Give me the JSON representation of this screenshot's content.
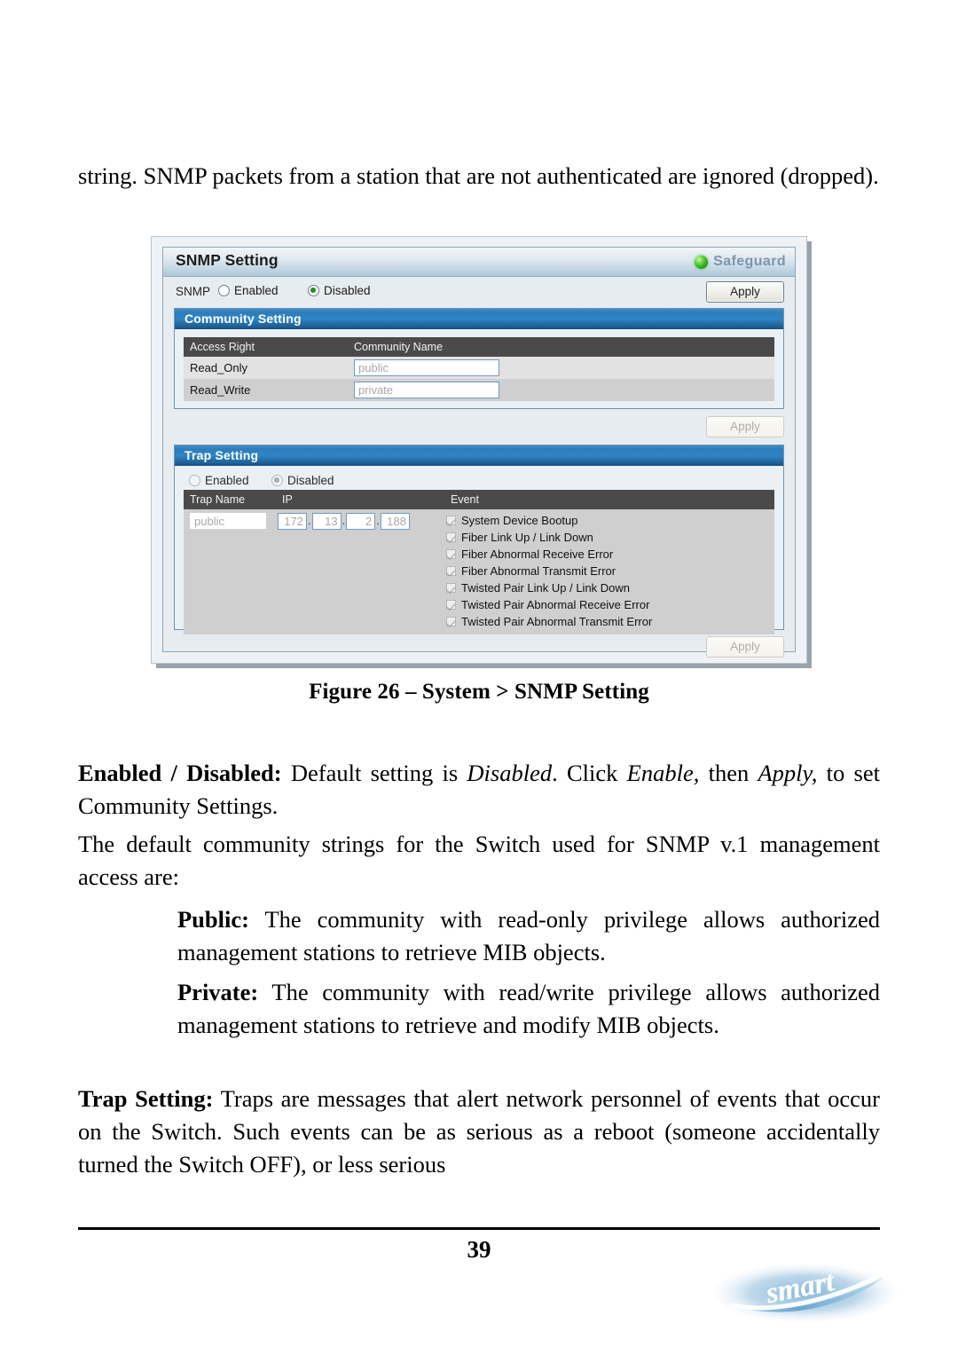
{
  "document": {
    "paragraphs": {
      "intro": "string. SNMP packets from a station that are not authenticated are ignored (dropped).",
      "enabled_disabled_lead": "Enabled / Disabled:",
      "enabled_disabled_rest_1": " Default setting is ",
      "enabled_disabled_italic_1": "Disabled",
      "enabled_disabled_rest_2": ". Click ",
      "enabled_disabled_italic_2": "Enable,",
      "enabled_disabled_rest_3": " then ",
      "enabled_disabled_italic_3": "Apply,",
      "enabled_disabled_rest_4": " to set Community Settings.",
      "default_strings": "The default community strings for the Switch used for SNMP v.1 management access are:",
      "public_lead": "Public:",
      "public_rest": " The community with read-only privilege allows authorized management stations to retrieve MIB objects.",
      "private_lead": "Private:",
      "private_rest": " The community with read/write privilege allows authorized management stations to retrieve and modify MIB objects.",
      "trap_lead": "Trap Setting:",
      "trap_rest": " Traps are messages that alert network personnel of events that occur on the Switch. Such events can be as serious as a reboot (someone accidentally turned the Switch OFF), or less serious"
    },
    "figure_caption": "Figure 26 – System > SNMP Setting",
    "page_number": "39",
    "logo_text": "smart"
  },
  "ui": {
    "title": "SNMP Setting",
    "safeguard_label": "Safeguard",
    "snmp": {
      "label": "SNMP",
      "options": [
        {
          "label": "Enabled",
          "selected": false
        },
        {
          "label": "Disabled",
          "selected": true
        }
      ],
      "apply_label": "Apply"
    },
    "community": {
      "panel_title": "Community Setting",
      "columns": [
        "Access Right",
        "Community Name"
      ],
      "rows": [
        {
          "access_right": "Read_Only",
          "community_name": "public"
        },
        {
          "access_right": "Read_Write",
          "community_name": "private"
        }
      ],
      "apply_label": "Apply",
      "apply_disabled": true
    },
    "trap": {
      "panel_title": "Trap Setting",
      "options": [
        {
          "label": "Enabled",
          "selected": false
        },
        {
          "label": "Disabled",
          "selected": true
        }
      ],
      "columns": [
        "Trap Name",
        "IP",
        "Event"
      ],
      "trap_name": "public",
      "ip": {
        "octet1": "172",
        "octet2": "13",
        "octet3": "2",
        "octet4": "188",
        "separator": "."
      },
      "events": [
        {
          "label": "System Device Bootup",
          "checked": true
        },
        {
          "label": "Fiber Link Up / Link Down",
          "checked": true
        },
        {
          "label": "Fiber Abnormal Receive Error",
          "checked": true
        },
        {
          "label": "Fiber Abnormal Transmit Error",
          "checked": true
        },
        {
          "label": "Twisted Pair Link Up / Link Down",
          "checked": true
        },
        {
          "label": "Twisted Pair Abnormal Receive Error",
          "checked": true
        },
        {
          "label": "Twisted Pair Abnormal Transmit Error",
          "checked": true
        }
      ],
      "apply_label": "Apply",
      "apply_disabled": true
    },
    "colors": {
      "panel_header_blue": "#2e86c6",
      "table_header_gray": "#4a4a4a",
      "led_green": "#54cc33",
      "safeguard_text": "#7d95ab",
      "input_border_blue": "#6d9cc4"
    }
  }
}
